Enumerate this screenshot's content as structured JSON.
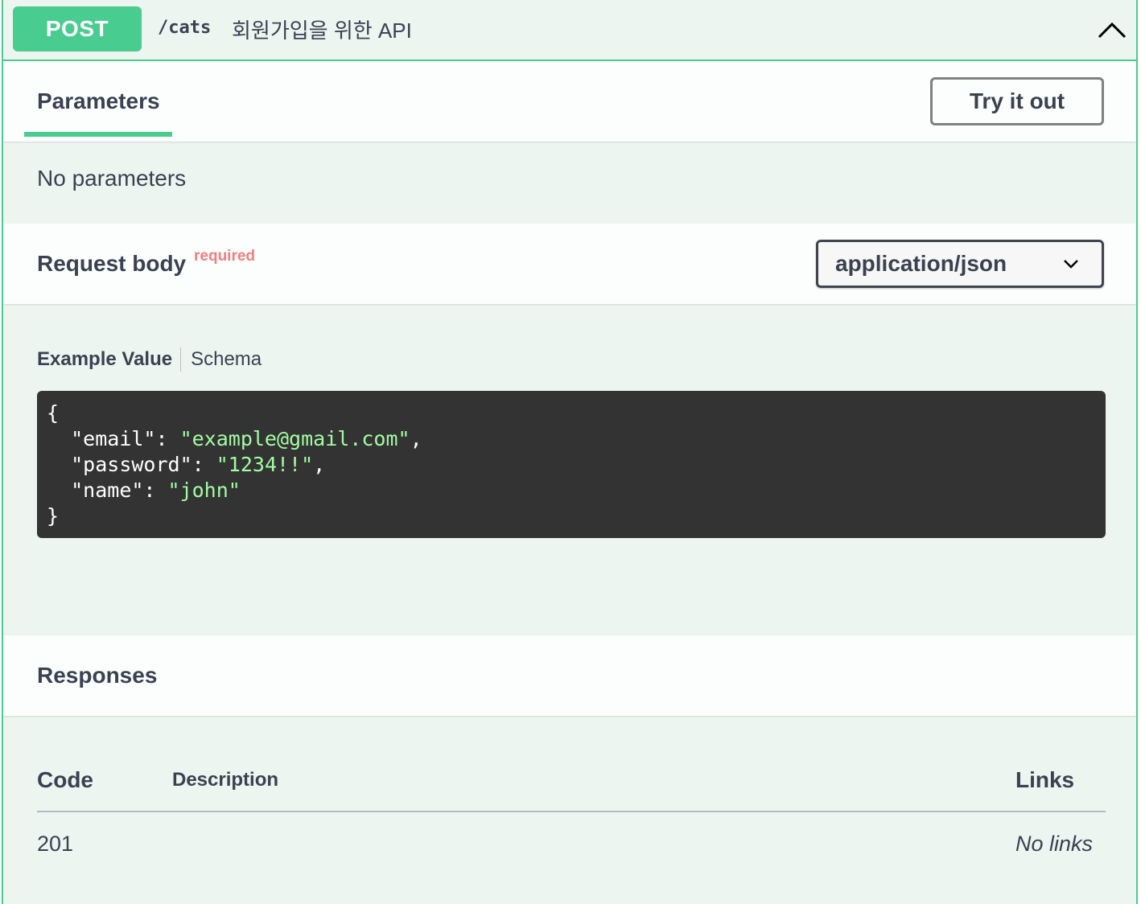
{
  "operation": {
    "method": "POST",
    "path": "/cats",
    "summary": "회원가입을 위한 API",
    "collapse_icon": "chevron-up-icon"
  },
  "parameters": {
    "tab_label": "Parameters",
    "try_button": "Try it out",
    "empty_text": "No parameters"
  },
  "request_body": {
    "title": "Request body",
    "required_label": "required",
    "content_type": "application/json",
    "tabs": [
      "Example Value",
      "Schema"
    ],
    "example": {
      "open_brace": "{",
      "close_brace": "}",
      "lines": [
        {
          "key": "\"email\"",
          "value": "\"example@gmail.com\"",
          "comma": ","
        },
        {
          "key": "\"password\"",
          "value": "\"1234!!\"",
          "comma": ","
        },
        {
          "key": "\"name\"",
          "value": "\"john\"",
          "comma": ""
        }
      ]
    }
  },
  "responses": {
    "title": "Responses",
    "columns": {
      "code": "Code",
      "description": "Description",
      "links": "Links"
    },
    "rows": [
      {
        "code": "201",
        "description": "",
        "links": "No links"
      }
    ]
  },
  "colors": {
    "accent": "#49cc90",
    "background": "#ecf5f0",
    "required": "#f27e7e",
    "code_bg": "#333333",
    "code_string": "#a2fca2"
  }
}
